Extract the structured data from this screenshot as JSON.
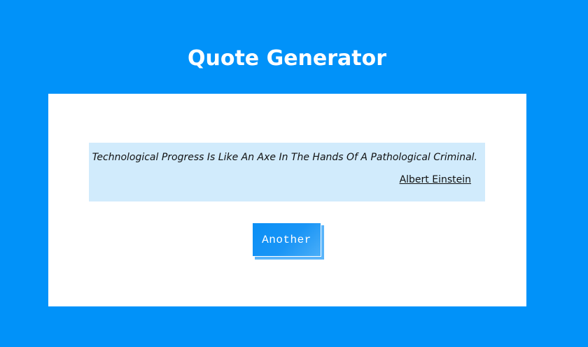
{
  "header": {
    "title": "Quote Generator"
  },
  "quote": {
    "text": "Technological Progress Is Like An Axe In The Hands Of A Pathological Criminal.",
    "author": "Albert Einstein"
  },
  "actions": {
    "another_label": "Another"
  },
  "colors": {
    "background": "#0192f9",
    "card": "#ffffff",
    "quote_box": "#d1ebfc",
    "button": "#0a8ff5",
    "button_shadow": "#5bb5fa"
  }
}
